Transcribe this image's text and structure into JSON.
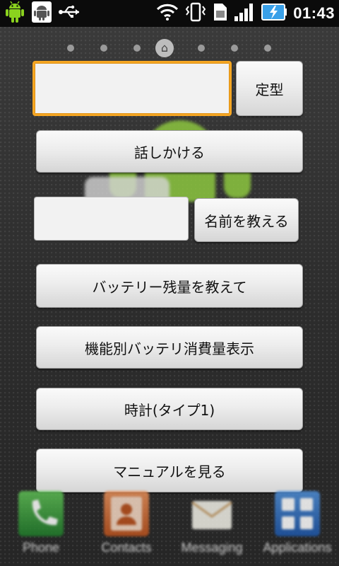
{
  "status_bar": {
    "time": "01:43",
    "icons": [
      "android-icon",
      "android-debug-icon",
      "usb-icon",
      "wifi-icon",
      "vibrate-icon",
      "sim-icon",
      "signal-icon",
      "battery-charging-icon"
    ]
  },
  "controls": {
    "template_input_value": "",
    "template_button_label": "定型",
    "talk_button_label": "話しかける",
    "name_input_value": "",
    "teach_name_button_label": "名前を教える",
    "battery_remaining_button_label": "バッテリー残量を教えて",
    "battery_by_function_button_label": "機能別バッテリ消費量表示",
    "clock_button_label": "時計(タイプ1)",
    "manual_button_label": "マニュアルを見る"
  },
  "dock": {
    "items": [
      {
        "label": "Phone",
        "icon": "phone-icon"
      },
      {
        "label": "Contacts",
        "icon": "contacts-icon"
      },
      {
        "label": "Messaging",
        "icon": "messaging-icon"
      },
      {
        "label": "Applications",
        "icon": "applications-icon"
      }
    ]
  },
  "colors": {
    "focus_accent": "#f5a623",
    "statusbar": "#0b0b0b",
    "battery_charge": "#39a0e8"
  }
}
